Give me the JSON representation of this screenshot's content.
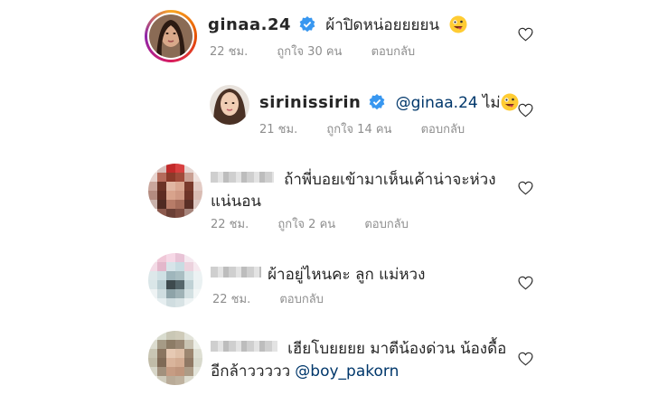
{
  "comments": [
    {
      "username": "ginaa.24",
      "verified": true,
      "text": "ผ้าปิดหน่อยยยยน",
      "time": "22 ชม.",
      "likes": "ถูกใจ 30 คน",
      "reply": "ตอบกลับ"
    },
    {
      "username": "sirinissirin",
      "verified": true,
      "mention": "@ginaa.24",
      "text": "ไม่",
      "time": "21 ชม.",
      "likes": "ถูกใจ 14 คน",
      "reply": "ตอบกลับ"
    },
    {
      "text_line1": "ถ้าพี่บอยเข้ามาเห็นเค้าน่าจะห่วง",
      "text_line2": "แน่นอน",
      "time": "22 ชม.",
      "likes": "ถูกใจ 2 คน",
      "reply": "ตอบกลับ"
    },
    {
      "text": "ผ้าอยู่ไหนคะ ลูก แม่หวง",
      "time": "22 ชม.",
      "reply": "ตอบกลับ"
    },
    {
      "text_line1": "เฮียโบยยยย มาตีน้องด่วน น้องดื้อ",
      "text_line2_prefix": "อีกล้าววววว",
      "mention": "@boy_pakorn"
    }
  ],
  "colors": {
    "mention": "#00376b",
    "verified": "#3897f0",
    "meta": "#8e8e8e"
  }
}
